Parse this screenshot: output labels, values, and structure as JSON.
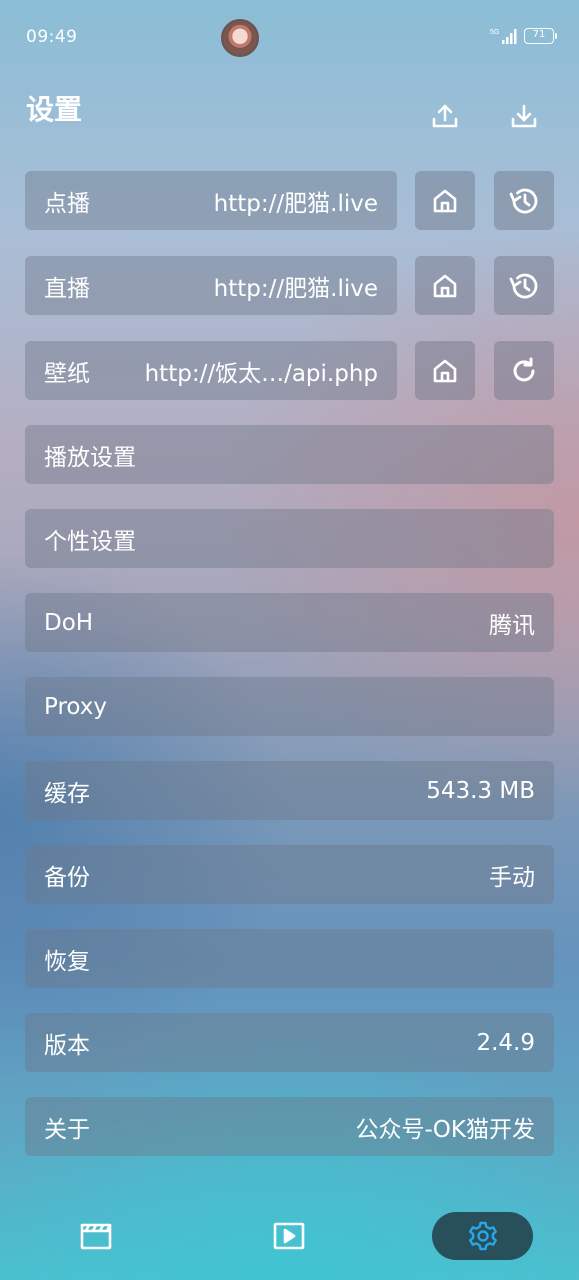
{
  "status_bar": {
    "time": "09:49",
    "network": "5G",
    "battery": "71"
  },
  "header": {
    "title": "设置"
  },
  "rows": {
    "vod": {
      "label": "点播",
      "value": "http://肥猫.live"
    },
    "live": {
      "label": "直播",
      "value": "http://肥猫.live"
    },
    "wallpaper": {
      "label": "壁纸",
      "value": "http://饭太…/api.php"
    },
    "playback": {
      "label": "播放设置"
    },
    "personal": {
      "label": "个性设置"
    },
    "doh": {
      "label": "DoH",
      "value": "腾讯"
    },
    "proxy": {
      "label": "Proxy"
    },
    "cache": {
      "label": "缓存",
      "value": "543.3 MB"
    },
    "backup": {
      "label": "备份",
      "value": "手动"
    },
    "restore": {
      "label": "恢复"
    },
    "version": {
      "label": "版本",
      "value": "2.4.9"
    },
    "about": {
      "label": "关于",
      "value": "公众号-OK猫开发"
    }
  },
  "icons": {
    "upload": "upload-icon",
    "download": "download-icon",
    "home": "home-icon",
    "history": "history-icon",
    "refresh": "refresh-icon",
    "nav_movie": "clapperboard-icon",
    "nav_play": "play-icon",
    "nav_settings": "gear-icon"
  },
  "colors": {
    "active_nav_bg": "#27505b",
    "active_nav_icon": "#2aa6e8",
    "row_bg": "rgba(110,118,135,0.42)"
  }
}
